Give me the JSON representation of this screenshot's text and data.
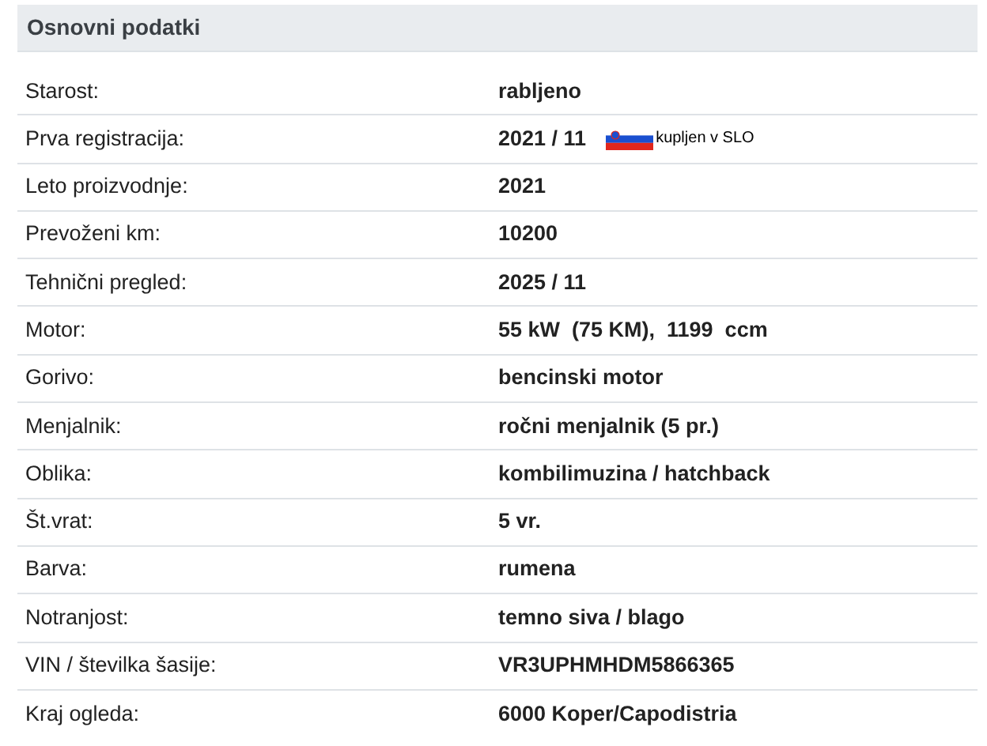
{
  "section": {
    "title": "Osnovni podatki"
  },
  "rows": [
    {
      "label": "Starost:",
      "value": "rabljeno"
    },
    {
      "label": "Prva registracija:",
      "value": "2021 / 11",
      "note": "kupljen v SLO"
    },
    {
      "label": "Leto proizvodnje:",
      "value": "2021"
    },
    {
      "label": "Prevoženi km:",
      "value": "10200"
    },
    {
      "label": "Tehnični pregled:",
      "value": "2025 / 11"
    },
    {
      "label": "Motor:",
      "value": "55 kW  (75 KM),  1199  ccm"
    },
    {
      "label": "Gorivo:",
      "value": "bencinski motor"
    },
    {
      "label": "Menjalnik:",
      "value": "ročni menjalnik (5 pr.)"
    },
    {
      "label": "Oblika:",
      "value": "kombilimuzina / hatchback"
    },
    {
      "label": "Št.vrat:",
      "value": "5 vr."
    },
    {
      "label": "Barva:",
      "value": "rumena"
    },
    {
      "label": "Notranjost:",
      "value": "temno siva / blago"
    },
    {
      "label": "VIN / številka šasije:",
      "value": "VR3UPHMHDM5866365"
    },
    {
      "label": "Kraj ogleda:",
      "value": "6000 Koper/Capodistria"
    }
  ]
}
